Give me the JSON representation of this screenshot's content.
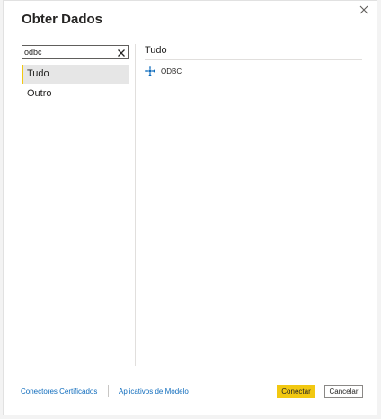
{
  "dialog": {
    "title": "Obter Dados",
    "close_icon": "close-icon"
  },
  "search": {
    "value": "odbc",
    "clear_icon": "clear-icon"
  },
  "nav": {
    "items": [
      {
        "label": "Tudo",
        "selected": true
      },
      {
        "label": "Outro",
        "selected": false
      }
    ]
  },
  "main": {
    "section_title": "Tudo",
    "connectors": [
      {
        "label": "ODBC",
        "icon": "odbc-connector-icon"
      }
    ]
  },
  "footer": {
    "link_certified": "Conectores Certificados",
    "link_templates": "Aplicativos de Modelo",
    "connect_label": "Conectar",
    "cancel_label": "Cancelar"
  },
  "colors": {
    "accent": "#f2c811",
    "link": "#0f6cbd",
    "text": "#252423"
  }
}
